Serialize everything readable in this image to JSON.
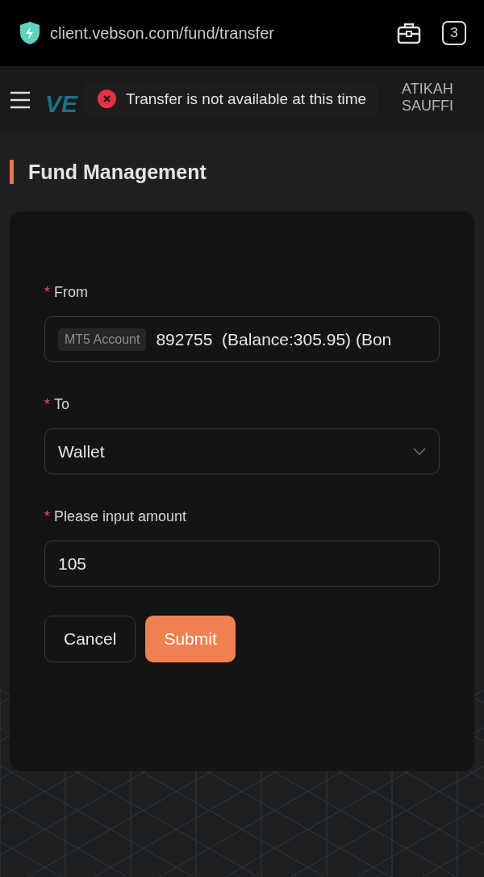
{
  "browser": {
    "url": "client.vebson.com/fund/transfer",
    "tab_count": "3"
  },
  "header": {
    "logo": "VE",
    "user_lines": [
      "ATIKAH",
      "SAUFFI"
    ]
  },
  "toast": {
    "kind": "error",
    "message": "Transfer is not available at this time"
  },
  "page_title": "Fund Management",
  "form": {
    "fields": [
      {
        "kind": "account",
        "label": "From",
        "required_mark": "*",
        "tag": "MT5 Account",
        "value": "892755  (Balance:305.95) (Bon"
      },
      {
        "kind": "select",
        "label": "To",
        "required_mark": "*",
        "value": "Wallet"
      },
      {
        "kind": "input",
        "label": "Please input amount",
        "required_mark": "*",
        "value": "105"
      }
    ],
    "buttons": [
      {
        "kind": "secondary",
        "label": "Cancel"
      },
      {
        "kind": "primary",
        "label": "Submit"
      }
    ]
  }
}
